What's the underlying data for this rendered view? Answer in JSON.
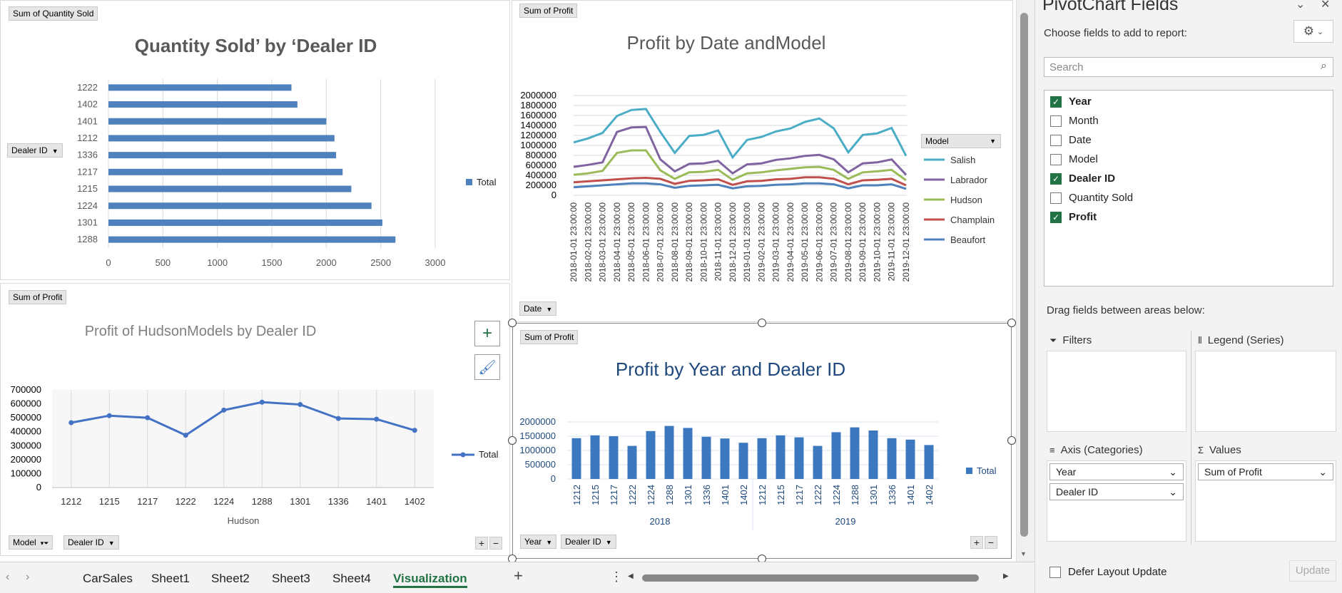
{
  "chart1": {
    "field_button": "Sum of Quantity Sold",
    "title": "Quantity Sold’ by ‘Dealer ID",
    "axis_button": "Dealer ID",
    "legend": "Total",
    "color": "#4f81bd"
  },
  "chart2": {
    "field_button": "Sum of Profit",
    "title": "Profit by Date andModel",
    "legend_title": "Model",
    "axis_button": "Date"
  },
  "chart3": {
    "field_button": "Sum of Profit",
    "title": "Profit of HudsonModels by Dealer ID",
    "xlabel": "Hudson",
    "legend": "Total",
    "filter_button": "Model",
    "axis_button": "Dealer ID"
  },
  "chart4": {
    "field_button": "Sum of Profit",
    "title": "Profit by Year and Dealer ID",
    "legend": "Total",
    "year_button": "Year",
    "dealer_button": "Dealer ID"
  },
  "chart_data": [
    {
      "type": "bar",
      "orientation": "horizontal",
      "categories": [
        "1222",
        "1402",
        "1401",
        "1212",
        "1336",
        "1217",
        "1215",
        "1224",
        "1301",
        "1288"
      ],
      "series": [
        {
          "name": "Total",
          "values": [
            1680,
            1735,
            2000,
            2075,
            2090,
            2150,
            2230,
            2415,
            2515,
            2635
          ]
        }
      ],
      "xlim": [
        0,
        3000
      ],
      "xticks": [
        "0",
        "500",
        "1000",
        "1500",
        "2000",
        "2500",
        "3000"
      ],
      "legend": "right"
    },
    {
      "type": "line",
      "x": [
        "2018-01-01 23:00:00",
        "2018-02-01 23:00:00",
        "2018-03-01 23:00:00",
        "2018-04-01 23:00:00",
        "2018-05-01 23:00:00",
        "2018-06-01 23:00:00",
        "2018-07-01 23:00:00",
        "2018-08-01 23:00:00",
        "2018-09-01 23:00:00",
        "2018-10-01 23:00:00",
        "2018-11-01 23:00:00",
        "2018-12-01 23:00:00",
        "2019-01-01 23:00:00",
        "2019-02-01 23:00:00",
        "2019-03-01 23:00:00",
        "2019-04-01 23:00:00",
        "2019-05-01 23:00:00",
        "2019-06-01 23:00:00",
        "2019-07-01 23:00:00",
        "2019-08-01 23:00:00",
        "2019-09-01 23:00:00",
        "2019-10-01 23:00:00",
        "2019-11-01 23:00:00",
        "2019-12-01 23:00:00"
      ],
      "ylim": [
        0,
        2000000
      ],
      "yticks": [
        "0",
        "200000",
        "400000",
        "600000",
        "800000",
        "1000000",
        "1200000",
        "1400000",
        "1600000",
        "1800000",
        "2000000"
      ],
      "series": [
        {
          "name": "Salish",
          "color": "#4bacc6",
          "values": [
            1060000,
            1140000,
            1250000,
            1590000,
            1710000,
            1730000,
            1270000,
            850000,
            1190000,
            1210000,
            1300000,
            760000,
            1110000,
            1170000,
            1280000,
            1340000,
            1470000,
            1540000,
            1340000,
            860000,
            1210000,
            1240000,
            1350000,
            790000
          ]
        },
        {
          "name": "Labrador",
          "color": "#8064a2",
          "values": [
            570000,
            610000,
            660000,
            1270000,
            1360000,
            1370000,
            720000,
            480000,
            630000,
            640000,
            690000,
            440000,
            620000,
            640000,
            710000,
            740000,
            790000,
            810000,
            720000,
            460000,
            640000,
            660000,
            720000,
            410000
          ]
        },
        {
          "name": "Hudson",
          "color": "#9bbb59",
          "values": [
            410000,
            440000,
            490000,
            850000,
            900000,
            900000,
            500000,
            330000,
            460000,
            470000,
            510000,
            310000,
            440000,
            460000,
            500000,
            530000,
            560000,
            570000,
            510000,
            330000,
            460000,
            480000,
            510000,
            300000
          ]
        },
        {
          "name": "Champlain",
          "color": "#c0504d",
          "values": [
            260000,
            280000,
            300000,
            320000,
            340000,
            350000,
            330000,
            230000,
            290000,
            300000,
            320000,
            210000,
            280000,
            290000,
            320000,
            330000,
            360000,
            360000,
            330000,
            220000,
            300000,
            310000,
            330000,
            200000
          ]
        },
        {
          "name": "Beaufort",
          "color": "#4f81bd",
          "values": [
            160000,
            180000,
            200000,
            220000,
            240000,
            240000,
            220000,
            150000,
            190000,
            200000,
            210000,
            140000,
            180000,
            190000,
            210000,
            220000,
            240000,
            240000,
            220000,
            140000,
            200000,
            200000,
            220000,
            130000
          ]
        }
      ],
      "legend": "right"
    },
    {
      "type": "line",
      "categories": [
        "1212",
        "1215",
        "1217",
        "1222",
        "1224",
        "1288",
        "1301",
        "1336",
        "1401",
        "1402"
      ],
      "series": [
        {
          "name": "Total",
          "values": [
            465000,
            515000,
            500000,
            375000,
            555000,
            612000,
            595000,
            495000,
            490000,
            410000
          ]
        }
      ],
      "ylim": [
        0,
        700000
      ],
      "yticks": [
        "0",
        "100000",
        "200000",
        "300000",
        "400000",
        "500000",
        "600000",
        "700000"
      ],
      "xlabel": "Hudson",
      "legend": "right"
    },
    {
      "type": "bar",
      "groups": [
        {
          "label": "2018",
          "categories": [
            "1212",
            "1215",
            "1217",
            "1222",
            "1224",
            "1288",
            "1301",
            "1336",
            "1401",
            "1402"
          ],
          "values": [
            1430000,
            1530000,
            1500000,
            1160000,
            1680000,
            1860000,
            1790000,
            1480000,
            1420000,
            1270000
          ]
        },
        {
          "label": "2019",
          "categories": [
            "1212",
            "1215",
            "1217",
            "1222",
            "1224",
            "1288",
            "1301",
            "1336",
            "1401",
            "1402"
          ],
          "values": [
            1430000,
            1530000,
            1460000,
            1160000,
            1640000,
            1810000,
            1700000,
            1430000,
            1380000,
            1190000
          ]
        }
      ],
      "series": [
        {
          "name": "Total",
          "color": "#3c78c0"
        }
      ],
      "ylim": [
        0,
        2000000
      ],
      "yticks": [
        "0",
        "500000",
        "1000000",
        "1500000",
        "2000000"
      ],
      "legend": "right"
    }
  ],
  "pane": {
    "title": "PivotChart Fields",
    "subtitle": "Choose fields to add to report:",
    "search_placeholder": "Search",
    "fields": [
      {
        "label": "Year",
        "checked": true
      },
      {
        "label": "Month",
        "checked": false
      },
      {
        "label": "Date",
        "checked": false
      },
      {
        "label": "Model",
        "checked": false
      },
      {
        "label": "Dealer ID",
        "checked": true
      },
      {
        "label": "Quantity Sold",
        "checked": false
      },
      {
        "label": "Profit",
        "checked": true
      }
    ],
    "drag_hint": "Drag fields between areas below:",
    "filters_label": "Filters",
    "legend_label": "Legend (Series)",
    "axis_label": "Axis (Categories)",
    "values_label": "Values",
    "axis_fields": [
      "Year",
      "Dealer ID"
    ],
    "value_fields": [
      "Sum of Profit"
    ],
    "defer_label": "Defer Layout Update",
    "update_label": "Update"
  },
  "tabs": {
    "items": [
      "CarSales",
      "Sheet1",
      "Sheet2",
      "Sheet3",
      "Sheet4",
      "Visualization"
    ],
    "active": "Visualization"
  }
}
